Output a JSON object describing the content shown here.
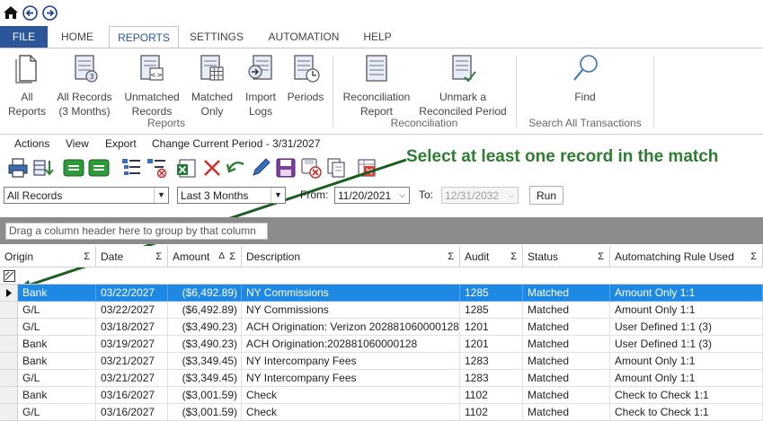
{
  "tabs": [
    "FILE",
    "HOME",
    "REPORTS",
    "SETTINGS",
    "AUTOMATION",
    "HELP"
  ],
  "ribbon": {
    "buttons": [
      {
        "label1": "All",
        "label2": "Reports"
      },
      {
        "label1": "All Records",
        "label2": "(3 Months)"
      },
      {
        "label1": "Unmatched",
        "label2": "Records"
      },
      {
        "label1": "Matched",
        "label2": "Only"
      },
      {
        "label1": "Import",
        "label2": "Logs"
      },
      {
        "label1": "Periods",
        "label2": ""
      },
      {
        "label1": "Reconciliation",
        "label2": "Report"
      },
      {
        "label1": "Unmark a",
        "label2": "Reconciled Period"
      },
      {
        "label1": "Find",
        "label2": ""
      }
    ],
    "groups": [
      "Reports",
      "Reconciliation",
      "Search All Transactions"
    ]
  },
  "menu": {
    "actions": "Actions",
    "view": "View",
    "export": "Export",
    "change_period": "Change Current Period - 3/31/2027"
  },
  "callout": "Select at least one record in the match",
  "filters": {
    "records": "All Records",
    "range": "Last 3 Months",
    "from_label": "From:",
    "from_value": "11/20/2021",
    "to_label": "To:",
    "to_value": "12/31/2032",
    "run": "Run"
  },
  "group_panel": "Drag a column header here to group by that column",
  "grid": {
    "columns": [
      "Origin",
      "Date",
      "Amount",
      "Description",
      "Audit",
      "Status",
      "Automatching Rule Used"
    ],
    "sigma": "Σ",
    "sort_indicator": "Δ",
    "rows": [
      [
        "Bank",
        "03/22/2027",
        "($6,492.89)",
        "NY Commissions",
        "1285",
        "Matched",
        "Amount Only 1:1"
      ],
      [
        "G/L",
        "03/22/2027",
        "($6,492.89)",
        "NY Commissions",
        "1285",
        "Matched",
        "Amount Only 1:1"
      ],
      [
        "G/L",
        "03/18/2027",
        "($3,490.23)",
        "ACH Origination: Verizon 202881060000128",
        "1201",
        "Matched",
        "User Defined 1:1 (3)"
      ],
      [
        "Bank",
        "03/19/2027",
        "($3,490.23)",
        "ACH Origination:202881060000128",
        "1201",
        "Matched",
        "User Defined 1:1 (3)"
      ],
      [
        "Bank",
        "03/21/2027",
        "($3,349.45)",
        "NY Intercompany Fees",
        "1283",
        "Matched",
        "Amount Only 1:1"
      ],
      [
        "G/L",
        "03/21/2027",
        "($3,349.45)",
        "NY Intercompany Fees",
        "1283",
        "Matched",
        "Amount Only 1:1"
      ],
      [
        "Bank",
        "03/16/2027",
        "($3,001.59)",
        "Check",
        "1102",
        "Matched",
        "Check to Check 1:1"
      ],
      [
        "G/L",
        "03/16/2027",
        "($3,001.59)",
        "Check",
        "1102",
        "Matched",
        "Check to Check 1:1"
      ]
    ],
    "selected_row": 0
  },
  "colors": {
    "accent": "#2b579a",
    "selection": "#1e88e5",
    "callout": "#2e7d32"
  }
}
